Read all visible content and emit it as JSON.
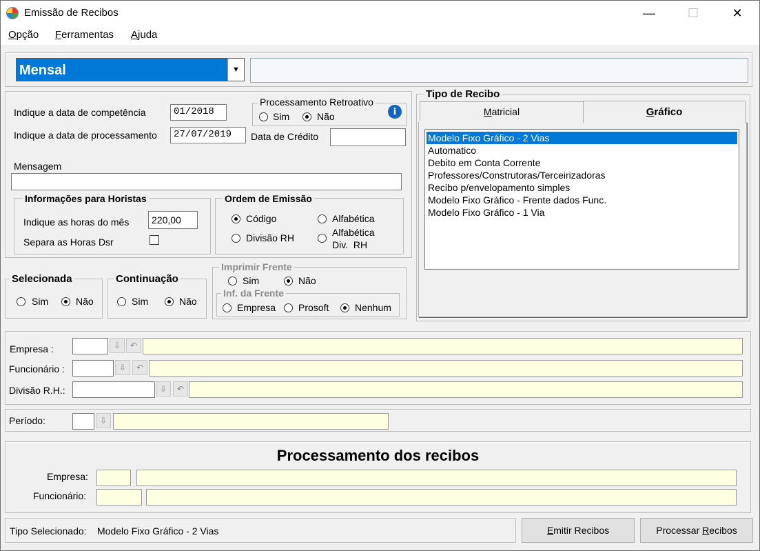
{
  "window": {
    "title": "Emissão de Recibos",
    "minimize": "—",
    "maximize": "☐",
    "close": "✕"
  },
  "menu": {
    "items": [
      {
        "accel": "O",
        "rest": "pção"
      },
      {
        "accel": "F",
        "rest": "erramentas"
      },
      {
        "accel": "A",
        "rest": "juda"
      }
    ]
  },
  "combo": {
    "value": "Mensal",
    "arrow": "▼"
  },
  "params": {
    "competencia_label": "Indique a data de competência",
    "competencia_value": "01/2018",
    "processamento_label": "Indique a data de processamento",
    "processamento_value": "27/07/2019",
    "retro_title": "Processamento Retroativo",
    "sim": "Sim",
    "nao": "Não",
    "credito_label": "Data de Crédito",
    "credito_value": "",
    "mensagem_label": "Mensagem",
    "mensagem_value": "",
    "info_icon": "i"
  },
  "horistas": {
    "title": "Informações para Horistas",
    "horas_label": "Indique as horas do mês",
    "horas_value": "220,00",
    "separa_label": "Separa as Horas Dsr"
  },
  "ordem": {
    "title": "Ordem de Emissão",
    "codigo": "Código",
    "alfabetica": "Alfabética",
    "divisao": "Divisão RH",
    "alfa_div_1": "Alfabética",
    "alfa_div_2": "Div.  RH"
  },
  "selecionada": {
    "title": "Selecionada",
    "sim": "Sim",
    "nao": "Não"
  },
  "continuacao": {
    "title": "Continuação",
    "sim": "Sim",
    "nao": "Não"
  },
  "imprimir": {
    "title": "Imprimir Frente",
    "sim": "Sim",
    "nao": "Não",
    "inf_title": "Inf. da Frente",
    "empresa": "Empresa",
    "prosoft": "Prosoft",
    "nenhum": "Nenhum"
  },
  "tipo_recibo": {
    "title": "Tipo de Recibo",
    "tab_matricial_accel": "M",
    "tab_matricial_rest": "atricial",
    "tab_grafico_accel": "G",
    "tab_grafico_rest": "ráfico",
    "items": [
      "Modelo Fixo Gráfico - 2 Vias",
      "Automatico",
      "Debito em Conta Corrente",
      "Professores/Construtoras/Terceirizadoras",
      "Recibo p/envelopamento simples",
      "Modelo Fixo Gráfico - Frente dados Func.",
      "Modelo Fixo Gráfico - 1 Via"
    ],
    "selected_index": 0
  },
  "filtros": {
    "empresa_label": "Empresa :",
    "funcionario_label": "Funcionário :",
    "divisao_label": "Divisão R.H.:",
    "periodo_label": "Período:"
  },
  "proc_recibos": {
    "title": "Processamento dos recibos",
    "empresa_label": "Empresa:",
    "funcionario_label": "Funcionário:"
  },
  "status": {
    "tipo_label": "Tipo Selecionado:",
    "tipo_value": "Modelo Fixo Gráfico - 2 Vias"
  },
  "buttons": {
    "emitir_accel": "E",
    "emitir_rest": "mitir Recibos",
    "processar_pre": "Processar ",
    "processar_accel": "R",
    "processar_rest": "ecibos"
  },
  "icons": {
    "download": "⇩",
    "undo": "↶"
  }
}
